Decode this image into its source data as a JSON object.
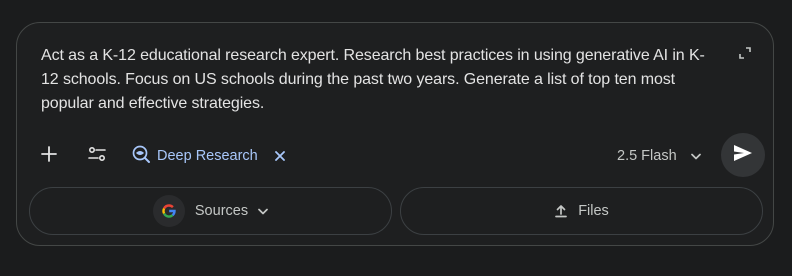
{
  "prompt": {
    "text": "Act as a K-12 educational research expert. Research best practices in using generative AI in K-12 schools. Focus on US schools during the past two years. Generate a list of top ten most popular and effective strategies."
  },
  "toolbar": {
    "add_icon": "plus-icon",
    "tools_icon": "tune-icon",
    "deep_research": {
      "label": "Deep Research",
      "icon": "deep-research-icon",
      "close_icon": "close-icon"
    },
    "model": {
      "label": "2.5 Flash",
      "icon": "chevron-down-icon"
    },
    "send_icon": "send-icon",
    "expand_icon": "expand-icon"
  },
  "sources": {
    "label": "Sources",
    "icon": "google-g-icon"
  },
  "files": {
    "label": "Files",
    "icon": "upload-icon"
  },
  "colors": {
    "background": "#1b1c1d",
    "card": "#1e1f20",
    "border": "#444746",
    "text": "#e3e3e3",
    "accent": "#a8c7fa",
    "muted": "#c4c7c5"
  }
}
